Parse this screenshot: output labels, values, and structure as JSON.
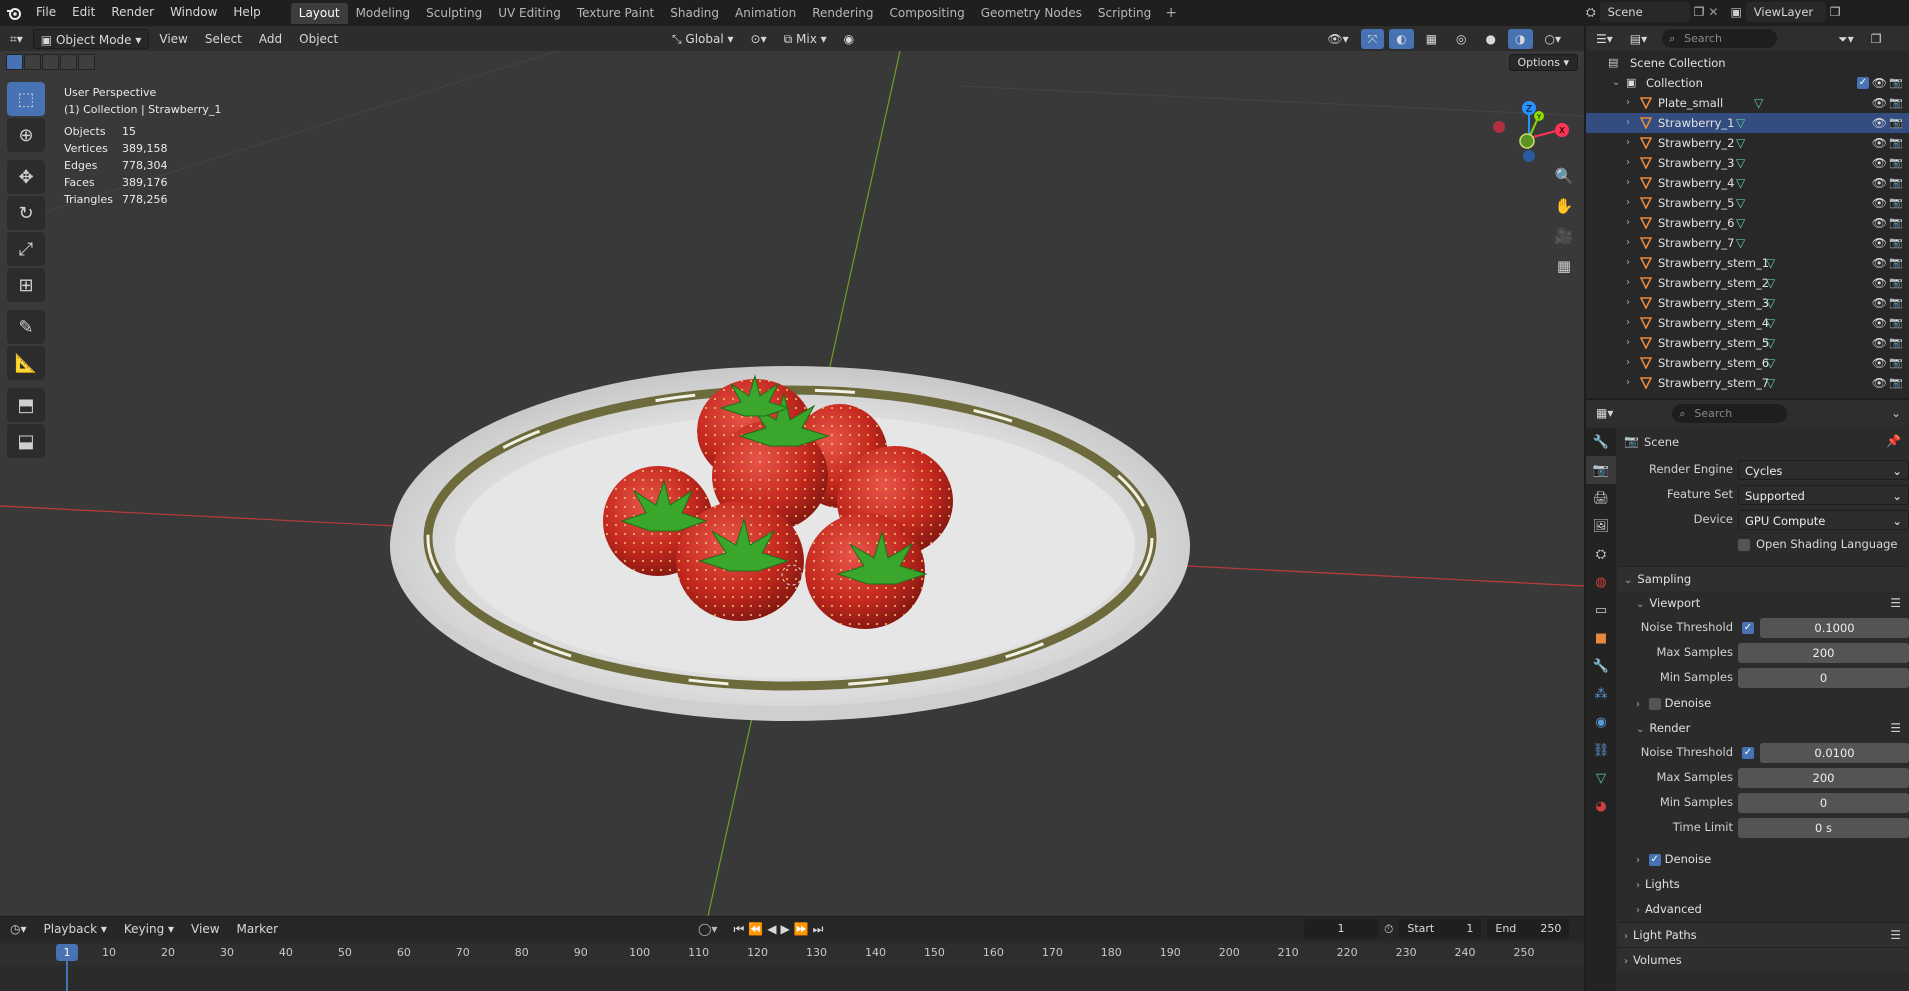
{
  "topbar": {
    "menu": [
      "File",
      "Edit",
      "Render",
      "Window",
      "Help"
    ],
    "workspaces": [
      "Layout",
      "Modeling",
      "Sculpting",
      "UV Editing",
      "Texture Paint",
      "Shading",
      "Animation",
      "Rendering",
      "Compositing",
      "Geometry Nodes",
      "Scripting"
    ],
    "active_workspace": "Layout",
    "plus": "+",
    "scene": "Scene",
    "view_layer": "ViewLayer"
  },
  "viewport": {
    "mode": "Object Mode",
    "menus": [
      "View",
      "Select",
      "Add",
      "Object"
    ],
    "orientation": "Global",
    "snap": "Mix",
    "options": "Options",
    "perspective": "User Perspective",
    "context": "(1) Collection | Strawberry_1",
    "stats": [
      {
        "label": "Objects",
        "value": "15"
      },
      {
        "label": "Vertices",
        "value": "389,158"
      },
      {
        "label": "Edges",
        "value": "778,304"
      },
      {
        "label": "Faces",
        "value": "389,176"
      },
      {
        "label": "Triangles",
        "value": "778,256"
      }
    ],
    "gizmo": {
      "x": "X",
      "y": "Y",
      "z": "Z"
    }
  },
  "timeline": {
    "menus": [
      "Playback",
      "Keying",
      "View",
      "Marker"
    ],
    "current_frame": "1",
    "start_label": "Start",
    "start": "1",
    "end_label": "End",
    "end": "250",
    "ticks": [
      "10",
      "20",
      "30",
      "40",
      "50",
      "60",
      "70",
      "80",
      "90",
      "100",
      "110",
      "120",
      "130",
      "140",
      "150",
      "160",
      "170",
      "180",
      "190",
      "200",
      "210",
      "220",
      "230",
      "240",
      "250"
    ],
    "cursor_label": "1"
  },
  "outliner": {
    "search_placeholder": "Search",
    "scene_collection": "Scene Collection",
    "collection": "Collection",
    "objects": [
      "Plate_small",
      "Strawberry_1",
      "Strawberry_2",
      "Strawberry_3",
      "Strawberry_4",
      "Strawberry_5",
      "Strawberry_6",
      "Strawberry_7",
      "Strawberry_stem_1",
      "Strawberry_stem_2",
      "Strawberry_stem_3",
      "Strawberry_stem_4",
      "Strawberry_stem_5",
      "Strawberry_stem_6",
      "Strawberry_stem_7"
    ]
  },
  "properties": {
    "search_placeholder": "Search",
    "title": "Scene",
    "render_engine_label": "Render Engine",
    "render_engine": "Cycles",
    "feature_set_label": "Feature Set",
    "feature_set": "Supported",
    "device_label": "Device",
    "device": "GPU Compute",
    "osl": "Open Shading Language",
    "sampling": "Sampling",
    "viewport": "Viewport",
    "render": "Render",
    "noise_threshold_label": "Noise Threshold",
    "max_samples_label": "Max Samples",
    "min_samples_label": "Min Samples",
    "time_limit_label": "Time Limit",
    "viewport_noise_threshold": "0.1000",
    "viewport_max_samples": "200",
    "viewport_min_samples": "0",
    "render_noise_threshold": "0.0100",
    "render_max_samples": "200",
    "render_min_samples": "0",
    "render_time_limit": "0 s",
    "denoise": "Denoise",
    "lights": "Lights",
    "advanced": "Advanced",
    "light_paths": "Light Paths",
    "volumes": "Volumes"
  },
  "colors": {
    "accent": "#4772b3",
    "axis_x": "#ff3352",
    "axis_y": "#8bdc00",
    "axis_z": "#2890ff",
    "mesh_icon": "#5fcf9d",
    "object_icon": "#e8883a"
  }
}
